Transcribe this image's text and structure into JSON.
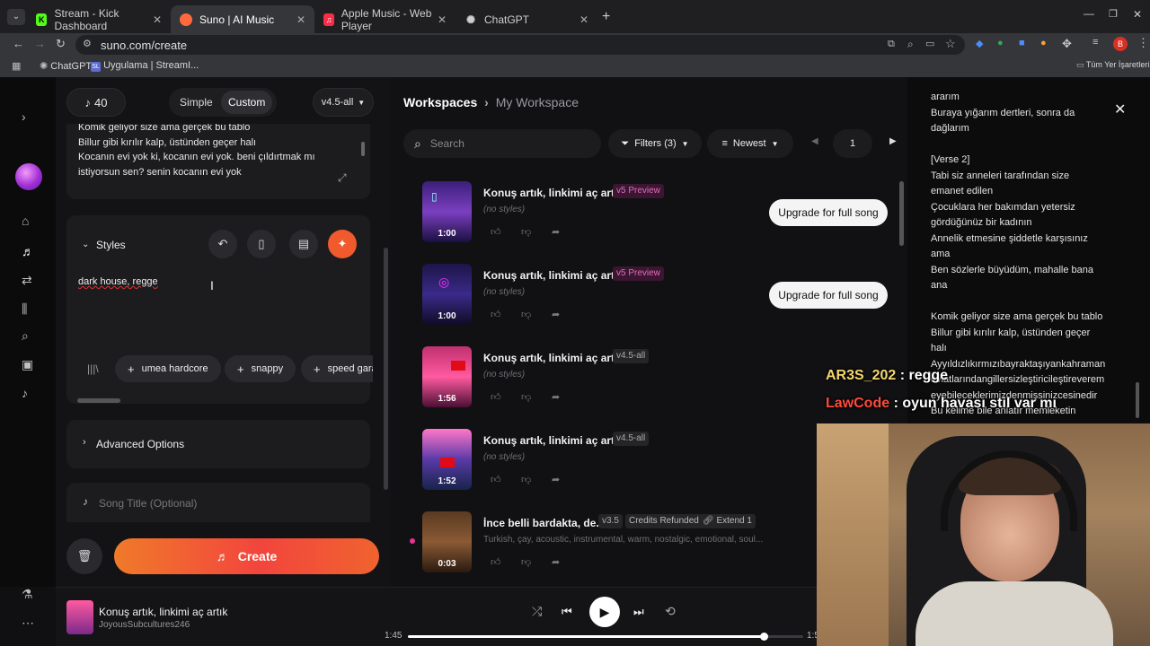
{
  "browser": {
    "tabs": [
      {
        "label": "Stream - Kick Dashboard",
        "color": "#53fc18",
        "glyph": "K"
      },
      {
        "label": "Suno | AI Music",
        "color": "#ff6a3d",
        "glyph": "●"
      },
      {
        "label": "Apple Music - Web Player",
        "color": "#fa2d48",
        "glyph": "♫"
      },
      {
        "label": "ChatGPT",
        "color": "#9aa0a6",
        "glyph": "✺"
      }
    ],
    "url": "suno.com/create",
    "bookmarks": [
      "ChatGPT",
      "Uygulama | StreamI..."
    ],
    "all_bookmarks": "Tüm Yer İşaretleri",
    "profile_initial": "B"
  },
  "left_panel": {
    "credits": "40",
    "mode_simple": "Simple",
    "mode_custom": "Custom",
    "version": "v4.5-all",
    "lyrics_lines": [
      "Komik geliyor size ama gerçek bu tablo",
      "Billur gibi kırılır kalp, üstünden geçer halı",
      "Kocanın evi yok ki, kocanın evi yok. beni çıldırtmak mı",
      "istiyorsun sen? senin kocanın evi yok"
    ],
    "styles_label": "Styles",
    "styles_value": "dark house, regge",
    "style_chips": [
      "umea hardcore",
      "snappy",
      "speed gara"
    ],
    "advanced_options": "Advanced Options",
    "song_title_placeholder": "Song Title (Optional)",
    "create_label": "Create"
  },
  "workspace": {
    "breadcrumb_root": "Workspaces",
    "breadcrumb_current": "My Workspace",
    "search_placeholder": "Search",
    "filters": "Filters (3)",
    "sort": "Newest",
    "page": "1",
    "upgrade_label": "Upgrade for full song",
    "songs": [
      {
        "title": "Konuş artık, linkimi aç artık",
        "tag": "v5 Preview",
        "tag_style": "preview",
        "sub": "(no styles)",
        "duration": "1:00",
        "upgrade": true
      },
      {
        "title": "Konuş artık, linkimi aç artık",
        "tag": "v5 Preview",
        "tag_style": "preview",
        "sub": "(no styles)",
        "duration": "1:00",
        "upgrade": true
      },
      {
        "title": "Konuş artık, linkimi aç artık",
        "tag": "v4.5-all",
        "tag_style": "plain",
        "sub": "(no styles)",
        "duration": "1:56",
        "upgrade": false
      },
      {
        "title": "Konuş artık, linkimi aç artık",
        "tag": "v4.5-all",
        "tag_style": "plain",
        "sub": "(no styles)",
        "duration": "1:52",
        "upgrade": false
      },
      {
        "title": "İnce belli bardakta, de...",
        "tag": "v3.5",
        "tag_style": "plain",
        "tag2": "Credits Refunded",
        "tag3": "Extend 1",
        "sub": "Turkish, çay, acoustic, instrumental, warm, nostalgic, emotional, soul...",
        "duration": "0:03",
        "upgrade": false
      }
    ]
  },
  "lyrics_panel": {
    "lines": [
      "ararım",
      "Buraya yığarım dertleri, sonra da",
      "dağlarım",
      "",
      "[Verse 2]",
      "Tabi siz anneleri tarafından size",
      "emanet edilen",
      "Çocuklara her bakımdan yetersiz",
      "gördüğünüz bir kadının",
      "Annelik etmesine şiddetle karşısınız",
      "ama",
      "Ben sözlerle büyüdüm, mahalle bana",
      "ana",
      "",
      "Komik geliyor size ama gerçek bu tablo",
      "Billur gibi kırılır kalp, üstünden geçer",
      "halı",
      "Ayyıldızlıkırmızıbayraktaşıyankahraman",
      "evlatlarındangillersizleştiricileştireverem",
      "eyebileceklerimizdenmişsinizcesinedir",
      "Bu kelime bile anlatır memleketin"
    ]
  },
  "chat": [
    {
      "user": "AR3S_202",
      "text": " : regge",
      "color": "#f5d76e"
    },
    {
      "user": "LawCode",
      "text": " : oyun havası stil var mı",
      "color": "#ff4a3d"
    }
  ],
  "player": {
    "title": "Konuş artık, linkimi aç artık",
    "artist": "JoyousSubcultures246",
    "elapsed": "1:45",
    "total": "1:5",
    "progress": 0.9
  }
}
